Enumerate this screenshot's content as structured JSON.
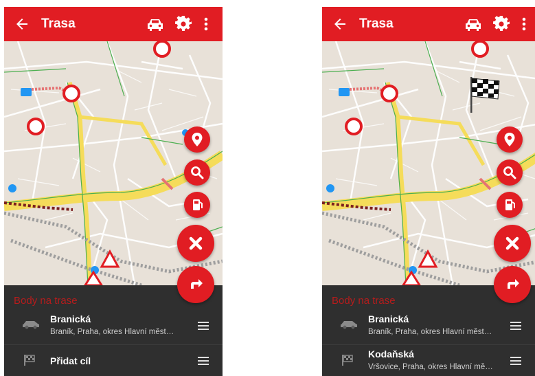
{
  "screens": [
    {
      "appbar": {
        "title": "Trasa"
      },
      "sheet": {
        "header": "Body na trase",
        "waypoints": [
          {
            "title": "Branická",
            "subtitle": "Braník, Praha, okres Hlavní město Praha",
            "icon": "car-icon"
          },
          {
            "title": "Přidat cíl",
            "subtitle": "",
            "icon": "flag-icon"
          }
        ]
      }
    },
    {
      "appbar": {
        "title": "Trasa"
      },
      "sheet": {
        "header": "Body na trase",
        "waypoints": [
          {
            "title": "Branická",
            "subtitle": "Braník, Praha, okres Hlavní město Praha",
            "icon": "car-icon"
          },
          {
            "title": "Kodaňská",
            "subtitle": "Vršovice, Praha, okres Hlavní město Praha",
            "icon": "flag-icon"
          }
        ]
      }
    }
  ],
  "colors": {
    "accent": "#e11d23",
    "sheet": "#2f2f2f",
    "map": "#e8e1d8",
    "highlight_road": "#f5dc5a"
  }
}
